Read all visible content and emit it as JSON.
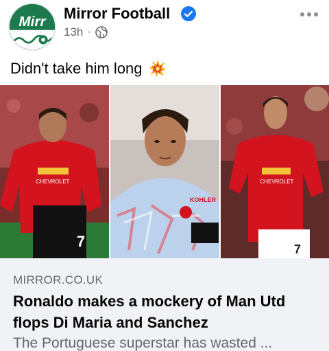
{
  "post": {
    "page_name": "Mirror Football",
    "timestamp": "13h",
    "separator": "·",
    "caption": "Didn't take him long",
    "caption_emoji": "collision-emoji",
    "verified": true,
    "avatar_text": "Mirr"
  },
  "media": {
    "images": [
      {
        "name": "player-left",
        "shirt_text": "CHEVROLET",
        "number": "7"
      },
      {
        "name": "player-center",
        "shirt_text": "KOHLER"
      },
      {
        "name": "player-right",
        "shirt_text": "CHEVROLET",
        "number": "7"
      }
    ]
  },
  "link_preview": {
    "domain": "MIRROR.CO.UK",
    "title": "Ronaldo makes a mockery of Man Utd flops Di Maria and Sanchez",
    "description": "The Portuguese superstar has wasted ..."
  },
  "colors": {
    "verified_blue": "#1877f2",
    "secondary_text": "#65676b",
    "card_bg": "#f0f2f5",
    "united_red": "#d3141f",
    "mirror_green": "#1c7a4d"
  },
  "icons": {
    "verified": "verified-badge-icon",
    "globe": "globe-icon",
    "more": "more-options-icon"
  }
}
